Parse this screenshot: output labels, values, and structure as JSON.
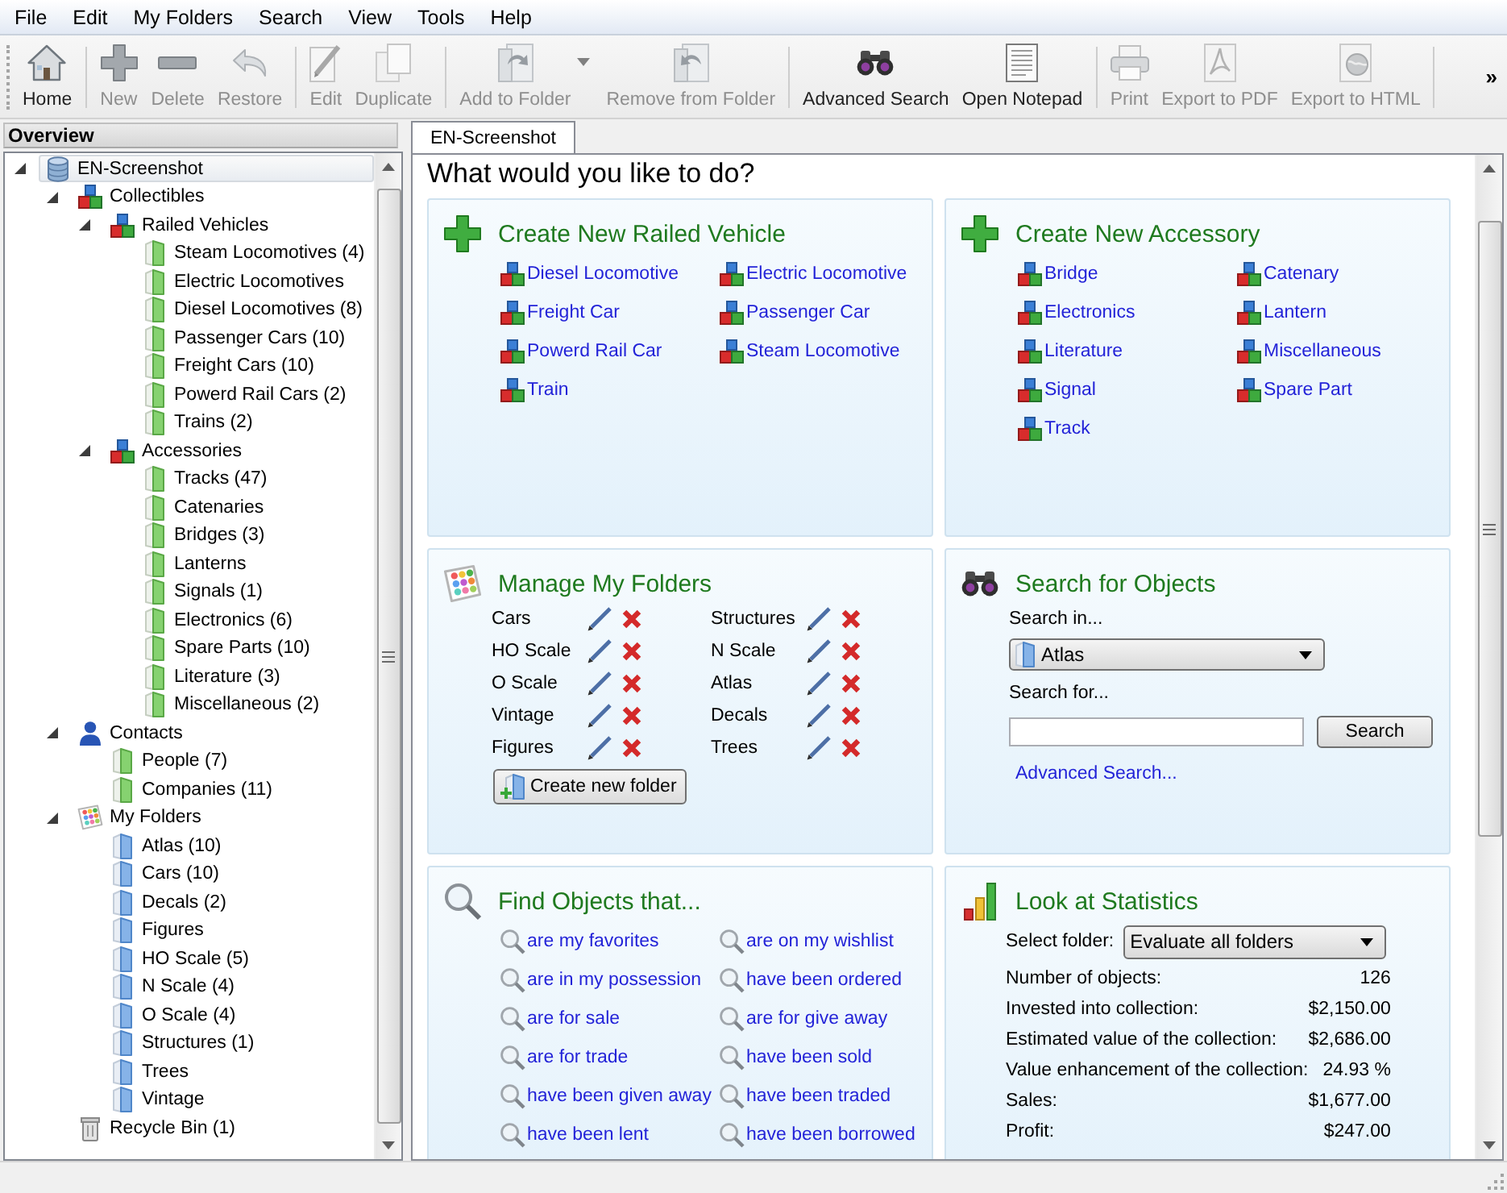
{
  "menu_bar": [
    "File",
    "Edit",
    "My Folders",
    "Search",
    "View",
    "Tools",
    "Help"
  ],
  "toolbar": {
    "groups": [
      [
        {
          "label": "Home",
          "kind": "home",
          "disabled": false,
          "dropdown": false
        }
      ],
      [
        {
          "label": "New",
          "kind": "new",
          "disabled": true,
          "dropdown": false
        },
        {
          "label": "Delete",
          "kind": "delete",
          "disabled": true,
          "dropdown": false
        },
        {
          "label": "Restore",
          "kind": "restore",
          "disabled": true,
          "dropdown": false
        }
      ],
      [
        {
          "label": "Edit",
          "kind": "edit",
          "disabled": true,
          "dropdown": false
        },
        {
          "label": "Duplicate",
          "kind": "duplicate",
          "disabled": true,
          "dropdown": false
        }
      ],
      [
        {
          "label": "Add to Folder",
          "kind": "add-to-folder",
          "disabled": true,
          "dropdown": true
        },
        {
          "label": "Remove from Folder",
          "kind": "remove-from-folder",
          "disabled": true,
          "dropdown": false
        }
      ],
      [
        {
          "label": "Advanced Search",
          "kind": "advanced-search",
          "disabled": false,
          "dropdown": false
        },
        {
          "label": "Open Notepad",
          "kind": "open-notepad",
          "disabled": false,
          "dropdown": false
        }
      ],
      [
        {
          "label": "Print",
          "kind": "print",
          "disabled": true,
          "dropdown": false
        },
        {
          "label": "Export to PDF",
          "kind": "export-pdf",
          "disabled": true,
          "dropdown": false
        },
        {
          "label": "Export to HTML",
          "kind": "export-html",
          "disabled": true,
          "dropdown": false
        }
      ]
    ],
    "overflow": "»"
  },
  "tree": {
    "title": "Overview",
    "items": [
      {
        "label": "EN-Screenshot",
        "kind": "database",
        "expanded": true,
        "selected": true,
        "children": [
          {
            "label": "Collectibles",
            "kind": "collection",
            "expanded": true,
            "selected": false,
            "children": [
              {
                "label": "Railed Vehicles",
                "kind": "collection",
                "expanded": true,
                "selected": false,
                "children": [
                  {
                    "label": "Steam Locomotives (4)",
                    "kind": "category",
                    "selected": false
                  },
                  {
                    "label": "Electric Locomotives",
                    "kind": "category",
                    "selected": false
                  },
                  {
                    "label": "Diesel Locomotives (8)",
                    "kind": "category",
                    "selected": false
                  },
                  {
                    "label": "Passenger Cars (10)",
                    "kind": "category",
                    "selected": false
                  },
                  {
                    "label": "Freight Cars (10)",
                    "kind": "category",
                    "selected": false
                  },
                  {
                    "label": "Powerd Rail Cars (2)",
                    "kind": "category",
                    "selected": false
                  },
                  {
                    "label": "Trains (2)",
                    "kind": "category",
                    "selected": false
                  }
                ]
              },
              {
                "label": "Accessories",
                "kind": "collection",
                "expanded": true,
                "selected": false,
                "children": [
                  {
                    "label": "Tracks (47)",
                    "kind": "category",
                    "selected": false
                  },
                  {
                    "label": "Catenaries",
                    "kind": "category",
                    "selected": false
                  },
                  {
                    "label": "Bridges (3)",
                    "kind": "category",
                    "selected": false
                  },
                  {
                    "label": "Lanterns",
                    "kind": "category",
                    "selected": false
                  },
                  {
                    "label": "Signals (1)",
                    "kind": "category",
                    "selected": false
                  },
                  {
                    "label": "Electronics (6)",
                    "kind": "category",
                    "selected": false
                  },
                  {
                    "label": "Spare Parts (10)",
                    "kind": "category",
                    "selected": false
                  },
                  {
                    "label": "Literature (3)",
                    "kind": "category",
                    "selected": false
                  },
                  {
                    "label": "Miscellaneous (2)",
                    "kind": "category",
                    "selected": false
                  }
                ]
              }
            ]
          },
          {
            "label": "Contacts",
            "kind": "contacts",
            "expanded": true,
            "selected": false,
            "children": [
              {
                "label": "People (7)",
                "kind": "category",
                "selected": false
              },
              {
                "label": "Companies (11)",
                "kind": "category",
                "selected": false
              }
            ]
          },
          {
            "label": "My Folders",
            "kind": "folders",
            "expanded": true,
            "selected": false,
            "children": [
              {
                "label": "Atlas (10)",
                "kind": "folder",
                "selected": false
              },
              {
                "label": "Cars (10)",
                "kind": "folder",
                "selected": false
              },
              {
                "label": "Decals (2)",
                "kind": "folder",
                "selected": false
              },
              {
                "label": "Figures",
                "kind": "folder",
                "selected": false
              },
              {
                "label": "HO Scale (5)",
                "kind": "folder",
                "selected": false
              },
              {
                "label": "N Scale (4)",
                "kind": "folder",
                "selected": false
              },
              {
                "label": "O Scale (4)",
                "kind": "folder",
                "selected": false
              },
              {
                "label": "Structures (1)",
                "kind": "folder",
                "selected": false
              },
              {
                "label": "Trees",
                "kind": "folder",
                "selected": false
              },
              {
                "label": "Vintage",
                "kind": "folder",
                "selected": false
              }
            ]
          },
          {
            "label": "Recycle Bin (1)",
            "kind": "bin",
            "selected": false
          }
        ]
      }
    ]
  },
  "tabs": [
    {
      "label": "EN-Screenshot",
      "selected": true
    }
  ],
  "start_page": {
    "heading": "What would you like to do?",
    "panels": [
      {
        "kind": "create",
        "title": "Create New Railed Vehicle",
        "links": [
          "Diesel Locomotive",
          "Electric Locomotive",
          "Freight Car",
          "Passenger Car",
          "Powerd Rail Car",
          "Steam Locomotive",
          "Train"
        ]
      },
      {
        "kind": "create",
        "title": "Create New Accessory",
        "links": [
          "Bridge",
          "Catenary",
          "Electronics",
          "Lantern",
          "Literature",
          "Miscellaneous",
          "Signal",
          "Spare Part",
          "Track"
        ]
      },
      {
        "kind": "folders",
        "title": "Manage My Folders",
        "folders": [
          "Cars",
          "Structures",
          "HO Scale",
          "N Scale",
          "O Scale",
          "Atlas",
          "Vintage",
          "Decals",
          "Figures",
          "Trees"
        ],
        "button": "Create new folder"
      },
      {
        "kind": "search",
        "title": "Search for Objects",
        "search_in": {
          "label": "Search in...",
          "value": "Atlas"
        },
        "search_for": {
          "label": "Search for..."
        },
        "button": "Search",
        "link": "Advanced Search..."
      },
      {
        "kind": "find",
        "title": "Find Objects that...",
        "links": [
          "are my favorites",
          "are on my wishlist",
          "are in my possession",
          "have been ordered",
          "are for sale",
          "are for give away",
          "are for trade",
          "have been sold",
          "have been given away",
          "have been traded",
          "have been lent",
          "have been borrowed"
        ]
      },
      {
        "kind": "statistics",
        "title": "Look at Statistics",
        "select": {
          "label": "Select folder:",
          "value": "Evaluate all folders"
        },
        "rows": [
          {
            "label": "Number of objects:",
            "value": "126"
          },
          {
            "label": "Invested into collection:",
            "value": "$2,150.00"
          },
          {
            "label": "Estimated value of the collection:",
            "value": "$2,686.00"
          },
          {
            "label": "Value enhancement of the collection:",
            "value": "24.93 %"
          },
          {
            "label": "Sales:",
            "value": "$1,677.00"
          },
          {
            "label": "Profit:",
            "value": "$247.00"
          }
        ]
      }
    ]
  }
}
